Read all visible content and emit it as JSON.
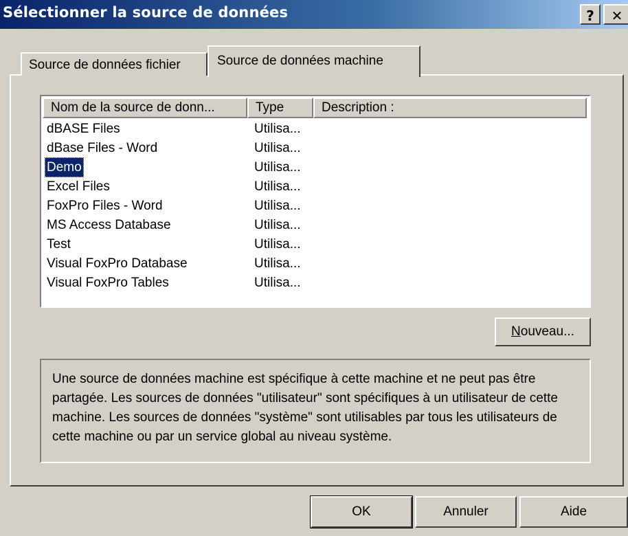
{
  "window": {
    "title": "Sélectionner la source de données",
    "help_button": "?",
    "close_button": "✕"
  },
  "tabs": [
    {
      "label": "Source de données fichier",
      "active": false
    },
    {
      "label": "Source de données machine",
      "active": true
    }
  ],
  "list": {
    "columns": [
      "Nom de la source de donn...",
      "Type",
      "Description :"
    ],
    "rows": [
      {
        "name": "dBASE Files",
        "type": "Utilisa..."
      },
      {
        "name": "dBase Files - Word",
        "type": "Utilisa..."
      },
      {
        "name": "Demo",
        "type": "Utilisa...",
        "selected": true
      },
      {
        "name": "Excel Files",
        "type": "Utilisa..."
      },
      {
        "name": "FoxPro Files - Word",
        "type": "Utilisa..."
      },
      {
        "name": "MS Access Database",
        "type": "Utilisa..."
      },
      {
        "name": "Test",
        "type": "Utilisa..."
      },
      {
        "name": "Visual FoxPro Database",
        "type": "Utilisa..."
      },
      {
        "name": "Visual FoxPro Tables",
        "type": "Utilisa..."
      }
    ]
  },
  "buttons": {
    "new_accel": "N",
    "new_rest": "ouveau...",
    "ok": "OK",
    "cancel": "Annuler",
    "help": "Aide"
  },
  "description": "Une source de données machine est spécifique à cette machine et ne peut pas être partagée. Les sources de données \"utilisateur\" sont spécifiques à un utilisateur de cette machine. Les sources de données \"système\" sont utilisables par tous les utilisateurs de cette machine ou par un service global au niveau système.",
  "colors": {
    "titlebar_start": "#0a246a",
    "titlebar_end": "#a6caf0",
    "face": "#d4d0c8",
    "selection": "#0a246a"
  }
}
